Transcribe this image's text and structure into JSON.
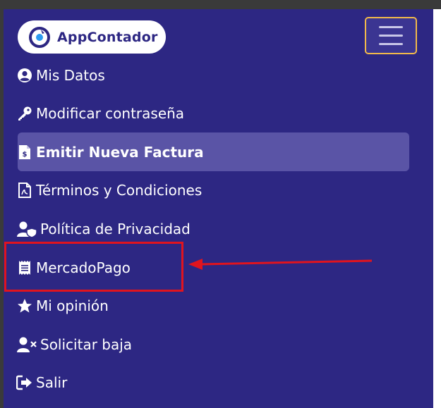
{
  "brand": {
    "name": "AppContador",
    "color": "#2d2783"
  },
  "colors": {
    "panel_bg": "#2d2783",
    "active_item_bg": "#5a54a6",
    "hamburger_border": "#f2b94a",
    "annotation_red": "#e0141e"
  },
  "menu": {
    "items": [
      {
        "label": "Mis Datos",
        "icon": "user-circle-icon"
      },
      {
        "label": "Modificar contraseña",
        "icon": "key-icon"
      },
      {
        "label": "Emitir Nueva Factura",
        "icon": "invoice-dollar-icon",
        "active": true
      },
      {
        "label": "Términos y Condiciones",
        "icon": "pdf-document-icon"
      },
      {
        "label": "Política de Privacidad",
        "icon": "user-shield-icon"
      },
      {
        "label": "MercadoPago",
        "icon": "receipt-icon"
      },
      {
        "label": "Mi opinión",
        "icon": "star-icon"
      },
      {
        "label": "Solicitar baja",
        "icon": "user-remove-icon"
      },
      {
        "label": "Salir",
        "icon": "sign-out-icon"
      }
    ]
  },
  "annotation": {
    "highlighted_item": "MercadoPago",
    "type": "arrow-pointing-left"
  }
}
